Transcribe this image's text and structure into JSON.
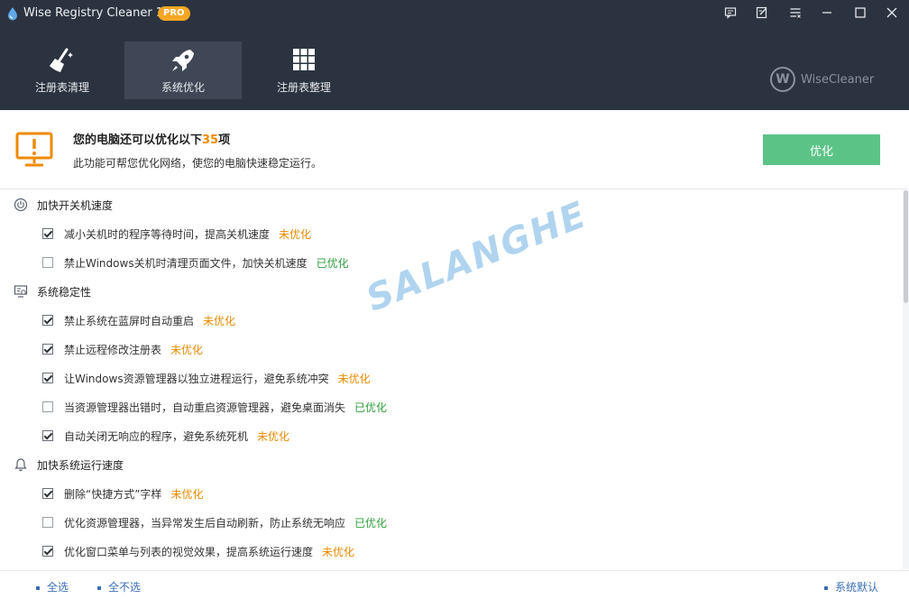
{
  "app": {
    "title": "Wise Registry Cleaner 11",
    "badge": "PRO",
    "brand": "WiseCleaner",
    "brand_letter": "W"
  },
  "window_controls": [
    "feedback-icon",
    "edit-icon",
    "menu-icon",
    "minimize-icon",
    "maximize-icon",
    "close-icon"
  ],
  "tabs": [
    {
      "label": "注册表清理",
      "icon": "broom-icon",
      "active": false
    },
    {
      "label": "系统优化",
      "icon": "rocket-icon",
      "active": true
    },
    {
      "label": "注册表整理",
      "icon": "grid-icon",
      "active": false
    }
  ],
  "summary": {
    "title_prefix": "您的电脑还可以优化以下",
    "count": "35",
    "title_suffix": "项",
    "subtitle": "此功能可帮您优化网络，使您的电脑快速稳定运行。",
    "button": "优化"
  },
  "groups": [
    {
      "label": "加快开关机速度",
      "icon": "power-icon",
      "items": [
        {
          "text": "减小关机时的程序等待时间，提高关机速度",
          "checked": true,
          "status": "未优化"
        },
        {
          "text": "禁止Windows关机时清理页面文件，加快关机速度",
          "checked": false,
          "status": "已优化"
        }
      ]
    },
    {
      "label": "系统稳定性",
      "icon": "monitor-gear-icon",
      "items": [
        {
          "text": "禁止系统在蓝屏时自动重启",
          "checked": true,
          "status": "未优化"
        },
        {
          "text": "禁止远程修改注册表",
          "checked": true,
          "status": "未优化"
        },
        {
          "text": "让Windows资源管理器以独立进程运行，避免系统冲突",
          "checked": true,
          "status": "未优化"
        },
        {
          "text": "当资源管理器出错时，自动重启资源管理器，避免桌面消失",
          "checked": false,
          "status": "已优化"
        },
        {
          "text": "自动关闭无响应的程序，避免系统死机",
          "checked": true,
          "status": "未优化"
        }
      ]
    },
    {
      "label": "加快系统运行速度",
      "icon": "bell-icon",
      "items": [
        {
          "text": "删除“快捷方式”字样",
          "checked": true,
          "status": "未优化"
        },
        {
          "text": "优化资源管理器，当异常发生后自动刷新，防止系统无响应",
          "checked": false,
          "status": "已优化"
        },
        {
          "text": "优化窗口菜单与列表的视觉效果，提高系统运行速度",
          "checked": true,
          "status": "未优化"
        }
      ]
    }
  ],
  "footer": {
    "select_all": "全选",
    "select_none": "全不选",
    "defaults": "系统默认"
  },
  "watermark": "SALANGHE",
  "colors": {
    "header_bg": "#2c3340",
    "accent_green": "#5cc387",
    "pending": "#e88a00",
    "done": "#2e9f3c",
    "badge": "#f5a623"
  }
}
